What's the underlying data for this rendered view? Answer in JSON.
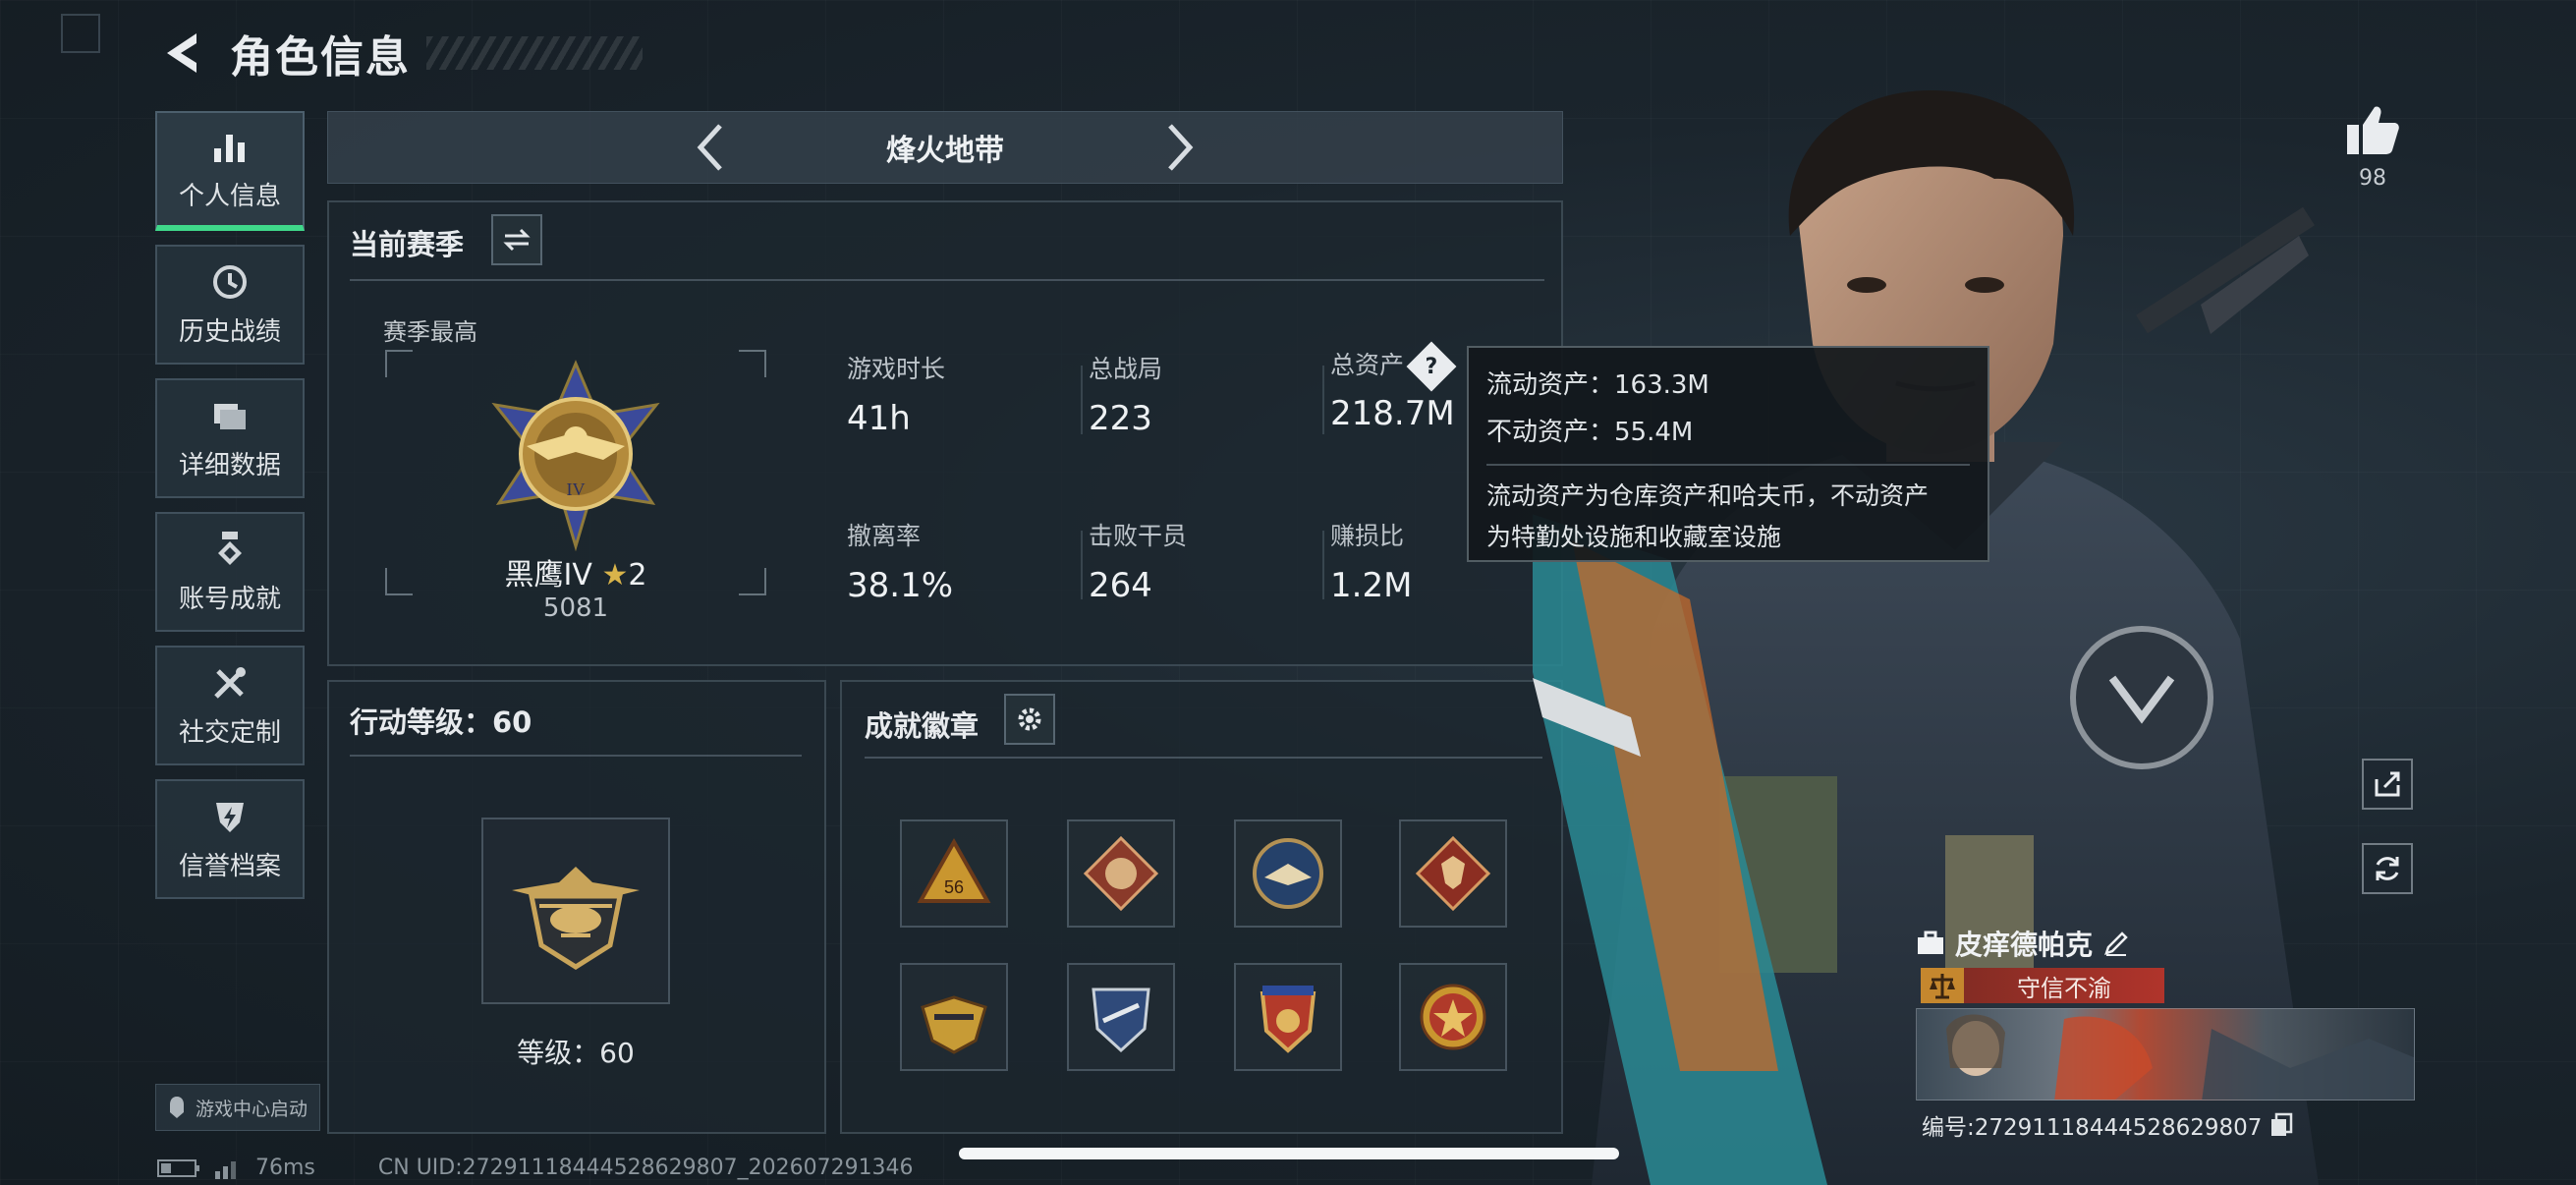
{
  "header": {
    "title": "角色信息"
  },
  "sidebar": {
    "items": [
      {
        "label": "个人信息",
        "icon": "bar-chart-icon",
        "active": true
      },
      {
        "label": "历史战绩",
        "icon": "history-clock-icon"
      },
      {
        "label": "详细数据",
        "icon": "folder-icon"
      },
      {
        "label": "账号成就",
        "icon": "medal-icon"
      },
      {
        "label": "社交定制",
        "icon": "tools-icon"
      },
      {
        "label": "信誉档案",
        "icon": "shield-bolt-icon"
      }
    ],
    "game_center": "游戏中心启动"
  },
  "mode": {
    "name": "烽火地带"
  },
  "season": {
    "title": "当前赛季",
    "best_label": "赛季最高",
    "rank_name": "黑鹰IV",
    "rank_stars": "2",
    "rank_score": "5081",
    "stats": [
      {
        "label": "游戏时长",
        "value": "41h"
      },
      {
        "label": "总战局",
        "value": "223"
      },
      {
        "label": "总资产",
        "value": "218.7M"
      },
      {
        "label": "撤离率",
        "value": "38.1%"
      },
      {
        "label": "击败干员",
        "value": "264"
      },
      {
        "label": "赚损比",
        "value": "1.2M"
      }
    ]
  },
  "tooltip": {
    "liquid": "流动资产：163.3M",
    "fixed": "不动资产：55.4M",
    "desc_line1": "流动资产为仓库资产和哈夫币，不动资产",
    "desc_line2": "为特勤处设施和收藏室设施"
  },
  "action_level": {
    "title": "行动等级：60",
    "level_text": "等级：60"
  },
  "badges": {
    "title": "成就徽章",
    "items": [
      "badge-56-triangle",
      "badge-dragon-red",
      "badge-eagle-blue",
      "badge-wolf-red",
      "badge-wings-gold",
      "badge-shield-blue",
      "badge-crest-red",
      "badge-star-red"
    ]
  },
  "profile": {
    "likes": "98",
    "name": "皮痒德帕克",
    "title": "守信不渝",
    "uid_line": "编号:27291118444528629807"
  },
  "status": {
    "ping": "76ms",
    "uid": "CN UID:27291118444528629807_202607291346"
  },
  "colors": {
    "accent": "#3fd88a",
    "panel": "#1c262e",
    "title_tag": "#b0342b"
  }
}
